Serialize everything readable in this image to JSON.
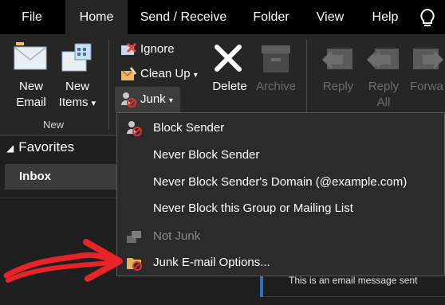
{
  "menu": {
    "tabs": [
      {
        "label": "File"
      },
      {
        "label": "Home"
      },
      {
        "label": "Send / Receive"
      },
      {
        "label": "Folder"
      },
      {
        "label": "View"
      },
      {
        "label": "Help"
      }
    ],
    "lightbulb_icon": "lightbulb-icon"
  },
  "ribbon": {
    "new_email": {
      "line1": "New",
      "line2": "Email"
    },
    "new_items": {
      "line1": "New",
      "line2": "Items",
      "arrow": "▾"
    },
    "group_new": "New",
    "ignore": "Ignore",
    "clean_up": "Clean Up",
    "junk": "Junk",
    "delete": "Delete",
    "archive": "Archive",
    "reply": "Reply",
    "reply_all": {
      "line1": "Reply",
      "line2": "All"
    },
    "forward": "Forwa",
    "dropdown_arrow": "▾"
  },
  "nav": {
    "favorites": "Favorites",
    "inbox": "Inbox"
  },
  "mail": {
    "preview": "This is an email message sent"
  },
  "junk_menu": {
    "block_sender": "Block Sender",
    "never_block_sender": "Never Block Sender",
    "never_block_domain": "Never Block Sender's Domain (@example.com)",
    "never_block_group": "Never Block this Group or Mailing List",
    "not_junk": "Not Junk",
    "junk_options": "Junk E-mail Options..."
  },
  "colors": {
    "accent_arrow": "#e8242a",
    "block_red": "#d9342b"
  }
}
